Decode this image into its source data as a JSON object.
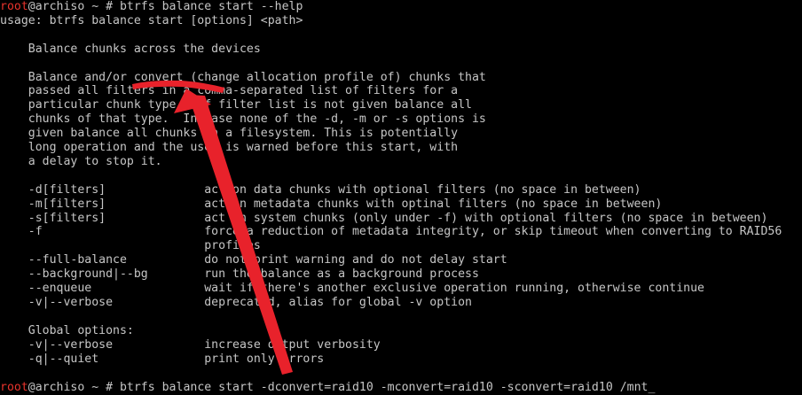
{
  "terminal": {
    "prompt": {
      "user": "root",
      "host_path": "@archiso ~ # "
    },
    "first_command": "btrfs balance start --help",
    "help_lines": [
      "usage: btrfs balance start [options] <path>",
      "",
      "    Balance chunks across the devices",
      "",
      "    Balance and/or convert (change allocation profile of) chunks that",
      "    passed all filters in a comma-separated list of filters for a",
      "    particular chunk type.  If filter list is not given balance all",
      "    chunks of that type.  In case none of the -d, -m or -s options is",
      "    given balance all chunks in a filesystem. This is potentially",
      "    long operation and the user is warned before this start, with",
      "    a delay to stop it.",
      "",
      "    -d[filters]              act on data chunks with optional filters (no space in between)",
      "    -m[filters]              act on metadata chunks with optinal filters (no space in between)",
      "    -s[filters]              act on system chunks (only under -f) with optional filters (no space in between)",
      "    -f                       force a reduction of metadata integrity, or skip timeout when converting to RAID56",
      "                             profiles",
      "    --full-balance           do not print warning and do not delay start",
      "    --background|--bg        run the balance as a background process",
      "    --enqueue                wait if there's another exclusive operation running, otherwise continue",
      "    -v|--verbose             deprecated, alias for global -v option",
      "",
      "    Global options:",
      "    -v|--verbose             increase output verbosity",
      "    -q|--quiet               print only errors"
    ],
    "last_command": "btrfs balance start -dconvert=raid10 -mconvert=raid10 -sconvert=raid10 /mnt",
    "cursor": "_"
  },
  "annotation_color": "#e8222b"
}
